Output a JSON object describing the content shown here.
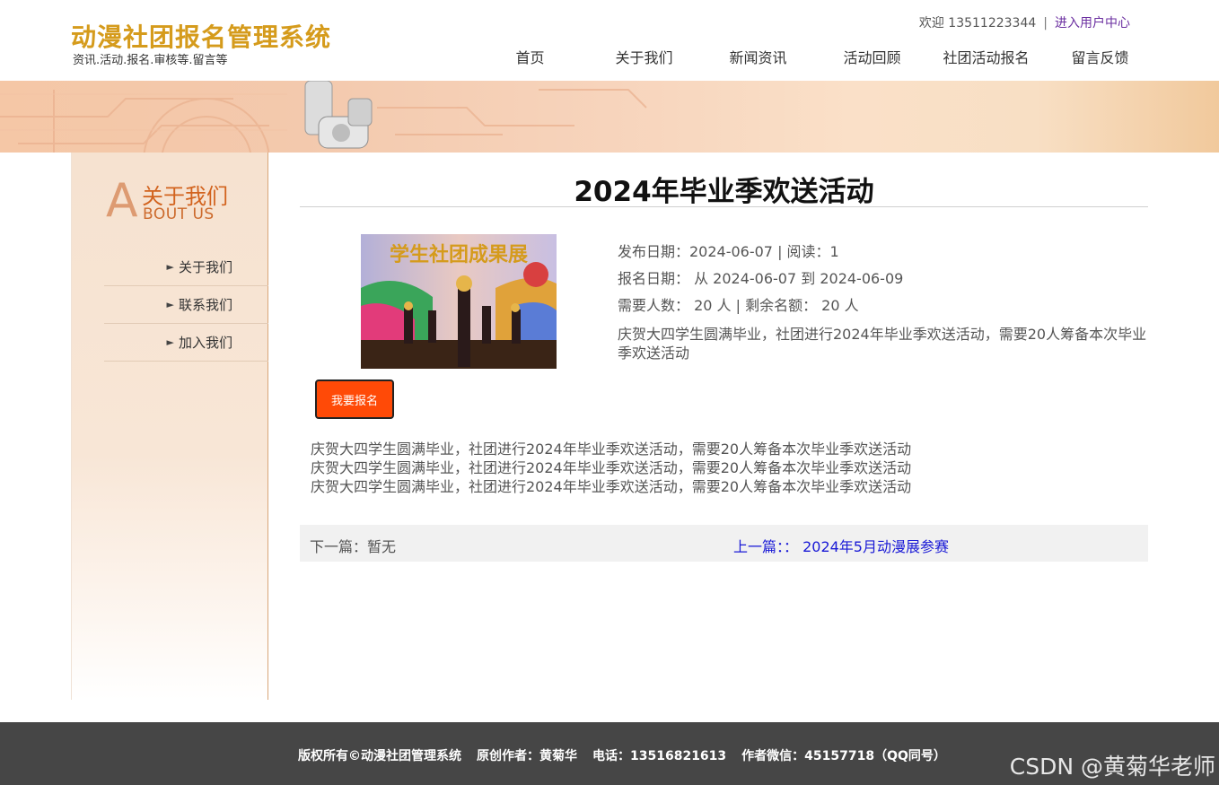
{
  "site": {
    "title": "动漫社团报名管理系统",
    "subtitle": "资讯.活动.报名.审核等.留言等"
  },
  "userbar": {
    "welcome": "欢迎 13511223344",
    "separator": "|",
    "user_center": "进入用户中心"
  },
  "nav": {
    "items": [
      "首页",
      "关于我们",
      "新闻资讯",
      "活动回顾",
      "社团活动报名",
      "留言反馈"
    ]
  },
  "sidebar": {
    "head_letter": "A",
    "head_cn": "关于我们",
    "head_en": "BOUT US",
    "items": [
      "关于我们",
      "联系我们",
      "加入我们"
    ]
  },
  "article": {
    "title": "2024年毕业季欢送活动",
    "photo_caption": "学生社团成果展",
    "meta_publish": "发布日期：2024-06-07  |  阅读：1",
    "meta_signup": "报名日期：  从 2024-06-07 到 2024-06-09",
    "meta_quota": "需要人数：  20 人       | 剩余名额：  20 人",
    "summary": "庆贺大四学生圆满毕业，社团进行2024年毕业季欢送活动，需要20人筹备本次毕业季欢送活动",
    "signup_button": "我要报名",
    "body_lines": [
      "庆贺大四学生圆满毕业，社团进行2024年毕业季欢送活动，需要20人筹备本次毕业季欢送活动",
      "庆贺大四学生圆满毕业，社团进行2024年毕业季欢送活动，需要20人筹备本次毕业季欢送活动",
      "庆贺大四学生圆满毕业，社团进行2024年毕业季欢送活动，需要20人筹备本次毕业季欢送活动"
    ]
  },
  "pager": {
    "next": "下一篇：暂无",
    "prev": "上一篇：：  2024年5月动漫展参赛"
  },
  "footer": {
    "copyright": "版权所有©动漫社团管理系统",
    "author": "原创作者：黄菊华",
    "phone": "电话：13516821613",
    "wechat": "作者微信：45157718（QQ同号）"
  },
  "watermark": "CSDN @黄菊华老师",
  "colors": {
    "brand": "#d59b1c",
    "button": "#ff4a07",
    "link": "#1a1ad6",
    "footer_bg": "#464646"
  }
}
